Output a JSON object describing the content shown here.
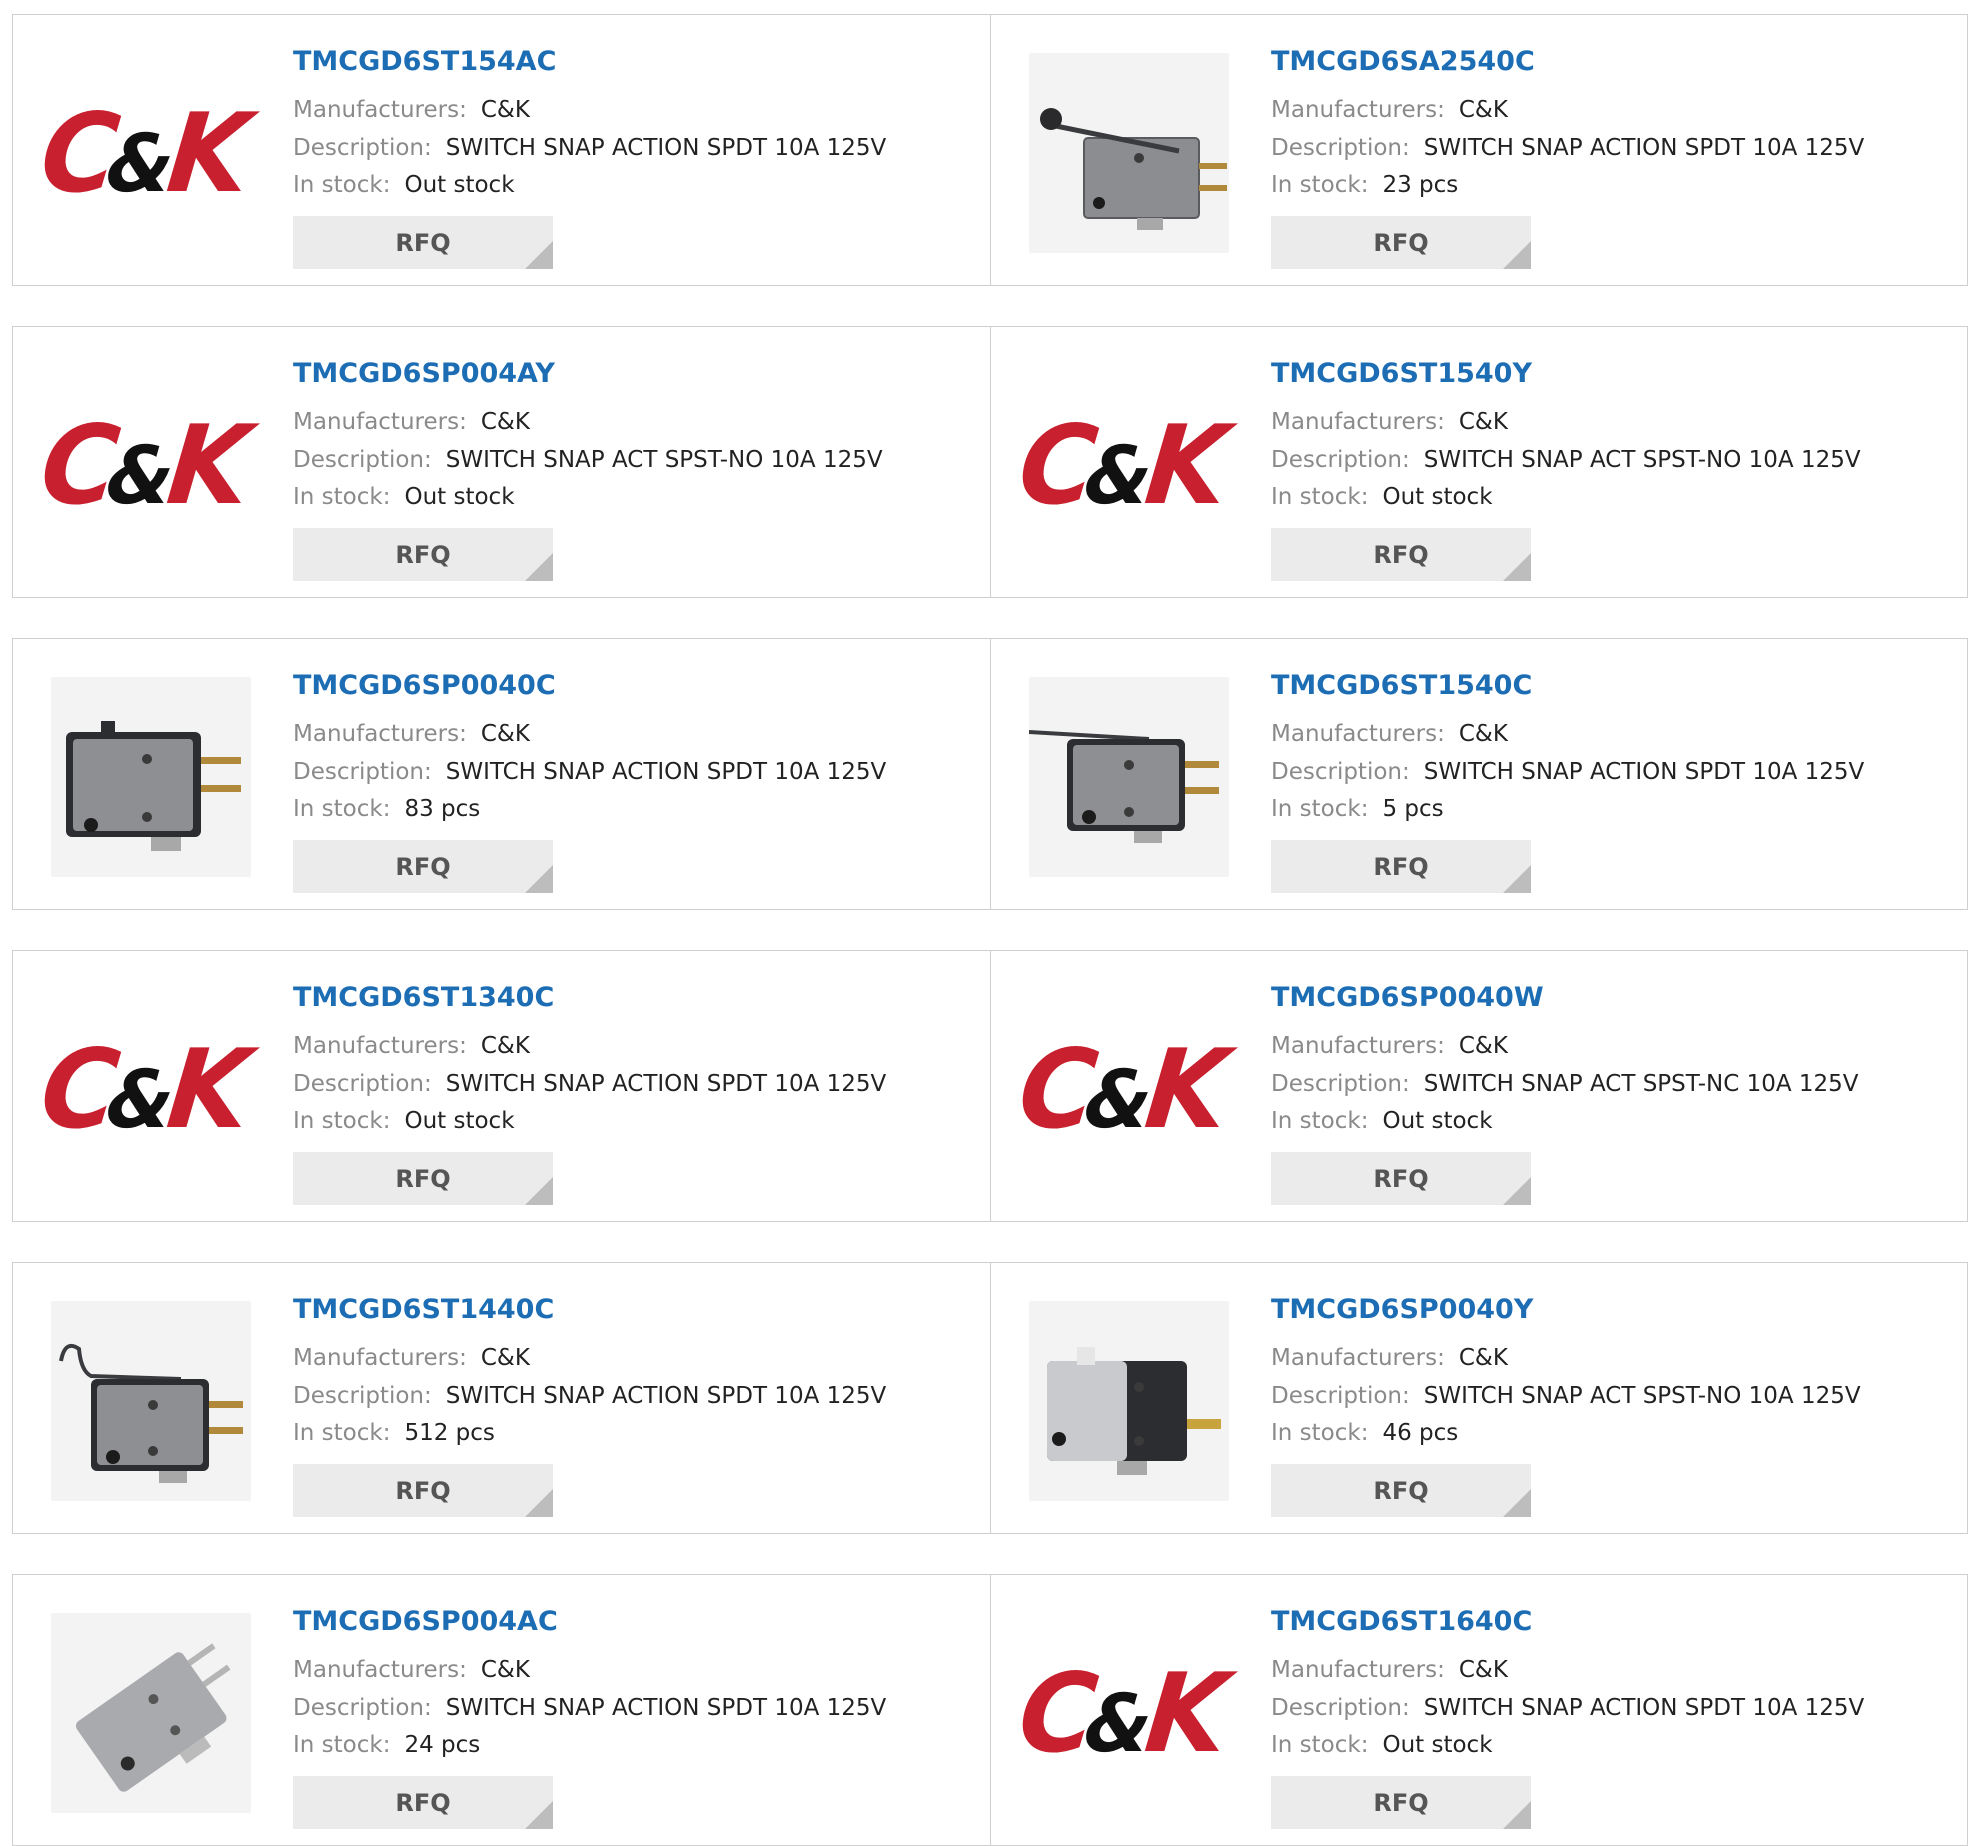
{
  "labels": {
    "manufacturer": "Manufacturers:",
    "description": "Description:",
    "stock": "In stock:",
    "rfq": "RFQ"
  },
  "logo": {
    "text_c": "C",
    "text_amp": "&",
    "text_k": "K",
    "reg": "®"
  },
  "products": [
    {
      "part": "TMCGD6ST154AC",
      "manufacturer": "C&K",
      "description": "SWITCH SNAP ACTION SPDT 10A 125V",
      "stock": "Out stock",
      "image": "ck-logo"
    },
    {
      "part": "TMCGD6SA2540C",
      "manufacturer": "C&K",
      "description": "SWITCH SNAP ACTION SPDT 10A 125V",
      "stock": "23 pcs",
      "image": "roller-lever-switch"
    },
    {
      "part": "TMCGD6SP004AY",
      "manufacturer": "C&K",
      "description": "SWITCH SNAP ACT SPST-NO 10A 125V",
      "stock": "Out stock",
      "image": "ck-logo"
    },
    {
      "part": "TMCGD6ST1540Y",
      "manufacturer": "C&K",
      "description": "SWITCH SNAP ACT SPST-NO 10A 125V",
      "stock": "Out stock",
      "image": "ck-logo"
    },
    {
      "part": "TMCGD6SP0040C",
      "manufacturer": "C&K",
      "description": "SWITCH SNAP ACTION SPDT 10A 125V",
      "stock": "83 pcs",
      "image": "pin-plunger-switch"
    },
    {
      "part": "TMCGD6ST1540C",
      "manufacturer": "C&K",
      "description": "SWITCH SNAP ACTION SPDT 10A 125V",
      "stock": "5 pcs",
      "image": "lever-switch"
    },
    {
      "part": "TMCGD6ST1340C",
      "manufacturer": "C&K",
      "description": "SWITCH SNAP ACTION SPDT 10A 125V",
      "stock": "Out stock",
      "image": "ck-logo"
    },
    {
      "part": "TMCGD6SP0040W",
      "manufacturer": "C&K",
      "description": "SWITCH SNAP ACT SPST-NC 10A 125V",
      "stock": "Out stock",
      "image": "ck-logo"
    },
    {
      "part": "TMCGD6ST1440C",
      "manufacturer": "C&K",
      "description": "SWITCH SNAP ACTION SPDT 10A 125V",
      "stock": "512 pcs",
      "image": "hooked-lever-switch"
    },
    {
      "part": "TMCGD6SP0040Y",
      "manufacturer": "C&K",
      "description": "SWITCH SNAP ACT SPST-NO 10A 125V",
      "stock": "46 pcs",
      "image": "white-plunger-switch"
    },
    {
      "part": "TMCGD6SP004AC",
      "manufacturer": "C&K",
      "description": "SWITCH SNAP ACTION SPDT 10A 125V",
      "stock": "24 pcs",
      "image": "angled-gray-switch"
    },
    {
      "part": "TMCGD6ST1640C",
      "manufacturer": "C&K",
      "description": "SWITCH SNAP ACTION SPDT 10A 125V",
      "stock": "Out stock",
      "image": "ck-logo"
    }
  ]
}
